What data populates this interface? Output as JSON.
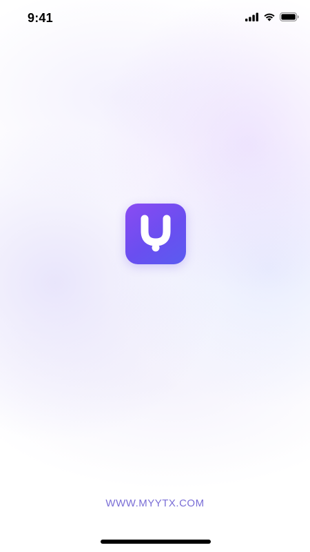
{
  "status_bar": {
    "time": "9:41",
    "icons": [
      "cellular-signal-icon",
      "wifi-icon",
      "battery-icon"
    ]
  },
  "app": {
    "icon_name": "app-logo-icon",
    "icon_gradient": [
      "#8a4bf2",
      "#5a5cf0"
    ],
    "glyph_color": "#ffffff"
  },
  "footer": {
    "url_text": "WWW.MYYTX.COM",
    "color": "#7a6ed6"
  }
}
